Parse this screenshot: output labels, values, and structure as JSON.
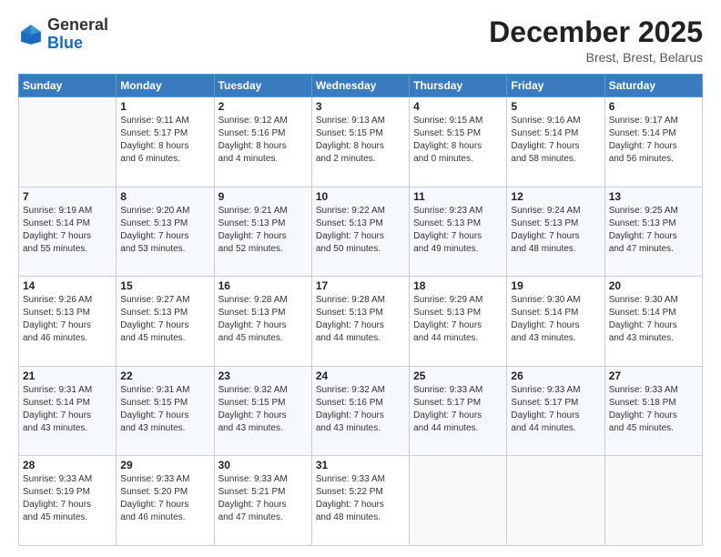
{
  "header": {
    "logo_general": "General",
    "logo_blue": "Blue",
    "month_title": "December 2025",
    "location": "Brest, Brest, Belarus"
  },
  "days_of_week": [
    "Sunday",
    "Monday",
    "Tuesday",
    "Wednesday",
    "Thursday",
    "Friday",
    "Saturday"
  ],
  "weeks": [
    [
      {
        "day": "",
        "info": ""
      },
      {
        "day": "1",
        "info": "Sunrise: 9:11 AM\nSunset: 5:17 PM\nDaylight: 8 hours\nand 6 minutes."
      },
      {
        "day": "2",
        "info": "Sunrise: 9:12 AM\nSunset: 5:16 PM\nDaylight: 8 hours\nand 4 minutes."
      },
      {
        "day": "3",
        "info": "Sunrise: 9:13 AM\nSunset: 5:15 PM\nDaylight: 8 hours\nand 2 minutes."
      },
      {
        "day": "4",
        "info": "Sunrise: 9:15 AM\nSunset: 5:15 PM\nDaylight: 8 hours\nand 0 minutes."
      },
      {
        "day": "5",
        "info": "Sunrise: 9:16 AM\nSunset: 5:14 PM\nDaylight: 7 hours\nand 58 minutes."
      },
      {
        "day": "6",
        "info": "Sunrise: 9:17 AM\nSunset: 5:14 PM\nDaylight: 7 hours\nand 56 minutes."
      }
    ],
    [
      {
        "day": "7",
        "info": "Sunrise: 9:19 AM\nSunset: 5:14 PM\nDaylight: 7 hours\nand 55 minutes."
      },
      {
        "day": "8",
        "info": "Sunrise: 9:20 AM\nSunset: 5:13 PM\nDaylight: 7 hours\nand 53 minutes."
      },
      {
        "day": "9",
        "info": "Sunrise: 9:21 AM\nSunset: 5:13 PM\nDaylight: 7 hours\nand 52 minutes."
      },
      {
        "day": "10",
        "info": "Sunrise: 9:22 AM\nSunset: 5:13 PM\nDaylight: 7 hours\nand 50 minutes."
      },
      {
        "day": "11",
        "info": "Sunrise: 9:23 AM\nSunset: 5:13 PM\nDaylight: 7 hours\nand 49 minutes."
      },
      {
        "day": "12",
        "info": "Sunrise: 9:24 AM\nSunset: 5:13 PM\nDaylight: 7 hours\nand 48 minutes."
      },
      {
        "day": "13",
        "info": "Sunrise: 9:25 AM\nSunset: 5:13 PM\nDaylight: 7 hours\nand 47 minutes."
      }
    ],
    [
      {
        "day": "14",
        "info": "Sunrise: 9:26 AM\nSunset: 5:13 PM\nDaylight: 7 hours\nand 46 minutes."
      },
      {
        "day": "15",
        "info": "Sunrise: 9:27 AM\nSunset: 5:13 PM\nDaylight: 7 hours\nand 45 minutes."
      },
      {
        "day": "16",
        "info": "Sunrise: 9:28 AM\nSunset: 5:13 PM\nDaylight: 7 hours\nand 45 minutes."
      },
      {
        "day": "17",
        "info": "Sunrise: 9:28 AM\nSunset: 5:13 PM\nDaylight: 7 hours\nand 44 minutes."
      },
      {
        "day": "18",
        "info": "Sunrise: 9:29 AM\nSunset: 5:13 PM\nDaylight: 7 hours\nand 44 minutes."
      },
      {
        "day": "19",
        "info": "Sunrise: 9:30 AM\nSunset: 5:14 PM\nDaylight: 7 hours\nand 43 minutes."
      },
      {
        "day": "20",
        "info": "Sunrise: 9:30 AM\nSunset: 5:14 PM\nDaylight: 7 hours\nand 43 minutes."
      }
    ],
    [
      {
        "day": "21",
        "info": "Sunrise: 9:31 AM\nSunset: 5:14 PM\nDaylight: 7 hours\nand 43 minutes."
      },
      {
        "day": "22",
        "info": "Sunrise: 9:31 AM\nSunset: 5:15 PM\nDaylight: 7 hours\nand 43 minutes."
      },
      {
        "day": "23",
        "info": "Sunrise: 9:32 AM\nSunset: 5:15 PM\nDaylight: 7 hours\nand 43 minutes."
      },
      {
        "day": "24",
        "info": "Sunrise: 9:32 AM\nSunset: 5:16 PM\nDaylight: 7 hours\nand 43 minutes."
      },
      {
        "day": "25",
        "info": "Sunrise: 9:33 AM\nSunset: 5:17 PM\nDaylight: 7 hours\nand 44 minutes."
      },
      {
        "day": "26",
        "info": "Sunrise: 9:33 AM\nSunset: 5:17 PM\nDaylight: 7 hours\nand 44 minutes."
      },
      {
        "day": "27",
        "info": "Sunrise: 9:33 AM\nSunset: 5:18 PM\nDaylight: 7 hours\nand 45 minutes."
      }
    ],
    [
      {
        "day": "28",
        "info": "Sunrise: 9:33 AM\nSunset: 5:19 PM\nDaylight: 7 hours\nand 45 minutes."
      },
      {
        "day": "29",
        "info": "Sunrise: 9:33 AM\nSunset: 5:20 PM\nDaylight: 7 hours\nand 46 minutes."
      },
      {
        "day": "30",
        "info": "Sunrise: 9:33 AM\nSunset: 5:21 PM\nDaylight: 7 hours\nand 47 minutes."
      },
      {
        "day": "31",
        "info": "Sunrise: 9:33 AM\nSunset: 5:22 PM\nDaylight: 7 hours\nand 48 minutes."
      },
      {
        "day": "",
        "info": ""
      },
      {
        "day": "",
        "info": ""
      },
      {
        "day": "",
        "info": ""
      }
    ]
  ]
}
